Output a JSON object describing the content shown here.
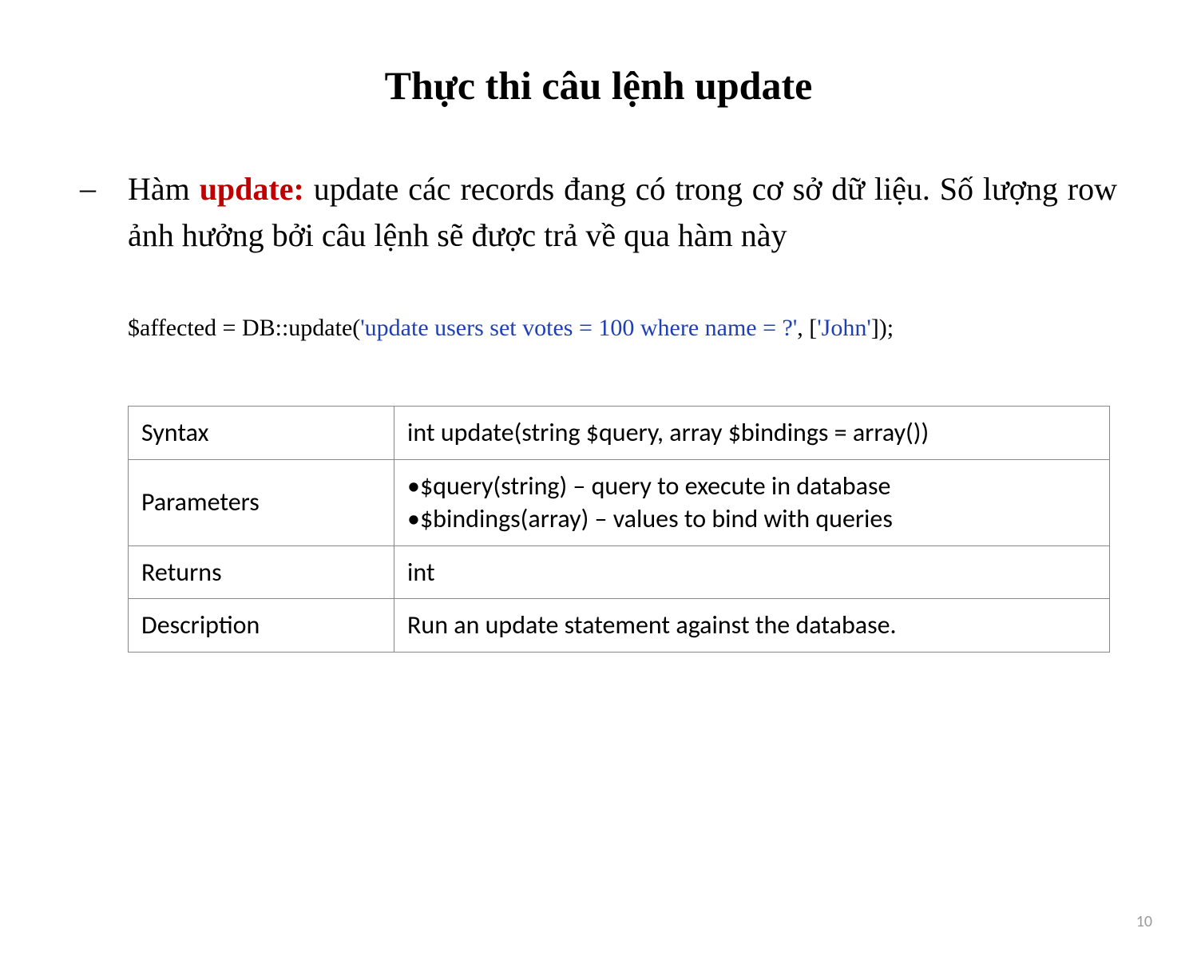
{
  "title": "Thực thi câu lệnh update",
  "bullet": {
    "dash": "–",
    "prefix": "Hàm ",
    "keyword": "update:",
    "rest": " update các records đang có trong cơ sở dữ liệu. Số lượng row ảnh hưởng bởi câu lệnh sẽ được trả về qua hàm này"
  },
  "code": {
    "p1": "$affected = DB::update(",
    "p2": "'update users set votes = 100 where name = ?'",
    "p3": ", [",
    "p4": "'John'",
    "p5": "]);"
  },
  "table": {
    "rows": [
      {
        "label": "Syntax",
        "value": "int update(string $query, array $bindings = array())"
      },
      {
        "label": "Parameters",
        "value": "•$query(string) – query to execute in database\n•$bindings(array) – values to bind with queries"
      },
      {
        "label": "Returns",
        "value": "int"
      },
      {
        "label": "Description",
        "value": "Run an update statement against the database."
      }
    ]
  },
  "page_number": "10"
}
